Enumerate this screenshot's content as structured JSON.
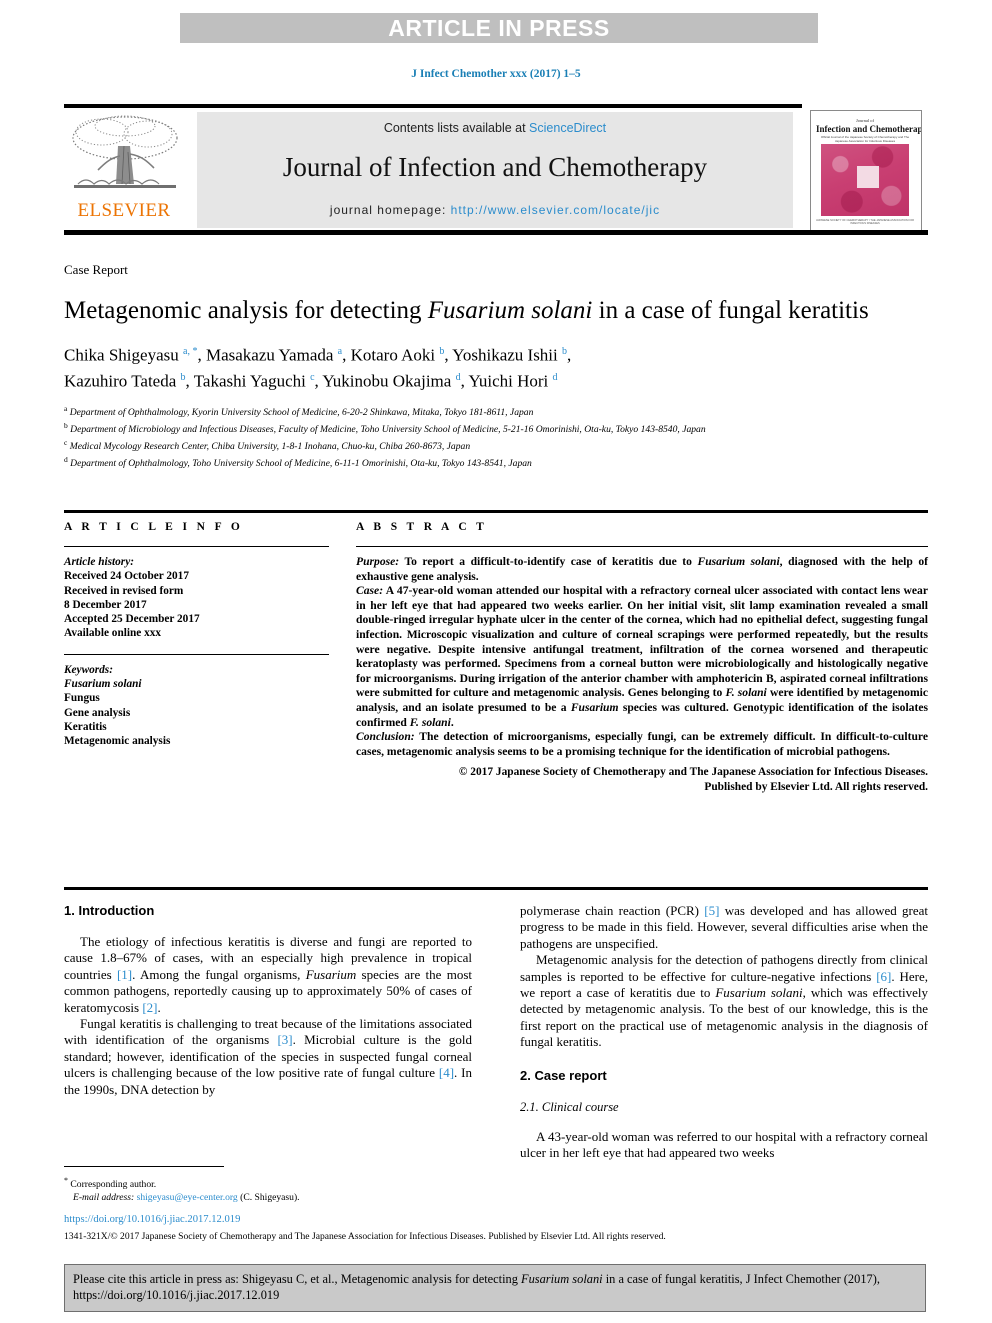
{
  "banner": {
    "label": "ARTICLE IN PRESS"
  },
  "running_citation": "J Infect Chemother xxx (2017) 1–5",
  "masthead": {
    "contents_prefix": "Contents lists available at ",
    "sciencedirect": "ScienceDirect",
    "journal_title": "Journal of Infection and Chemotherapy",
    "homepage_prefix": "journal homepage: ",
    "homepage_url": "http://www.elsevier.com/locate/jic",
    "publisher_logo_text": "ELSEVIER",
    "cover": {
      "line1": "Journal of",
      "line2": "Infection and Chemotherapy",
      "line3": "Official Journal of the Japanese Society of Chemotherapy and The Japanese Association for Infectious Diseases",
      "footer": "JAPANESE SOCIETY OF CHEMOTHERAPY / THE JAPANESE ASSOCIATION FOR INFECTIOUS DISEASES"
    }
  },
  "article": {
    "type_label": "Case Report",
    "title_part1": "Metagenomic analysis for detecting ",
    "title_italic": "Fusarium solani",
    "title_part2": " in a case of fungal keratitis",
    "authors_line1": "Chika Shigeyasu ",
    "authors_line1_sup1": "a, *",
    "authors_line1_b": ", Masakazu Yamada ",
    "authors_line1_sup2": "a",
    "authors_line1_c": ", Kotaro Aoki ",
    "authors_line1_sup3": "b",
    "authors_line1_d": ", Yoshikazu Ishii ",
    "authors_line1_sup4": "b",
    "authors_line1_e": ",",
    "authors_line2": "Kazuhiro Tateda ",
    "authors_line2_sup1": "b",
    "authors_line2_b": ", Takashi Yaguchi ",
    "authors_line2_sup2": "c",
    "authors_line2_c": ", Yukinobu Okajima ",
    "authors_line2_sup3": "d",
    "authors_line2_d": ", Yuichi Hori ",
    "authors_line2_sup4": "d",
    "affiliations": [
      {
        "marker": "a",
        "text": "Department of Ophthalmology, Kyorin University School of Medicine, 6-20-2 Shinkawa, Mitaka, Tokyo 181-8611, Japan"
      },
      {
        "marker": "b",
        "text": "Department of Microbiology and Infectious Diseases, Faculty of Medicine, Toho University School of Medicine, 5-21-16 Omorinishi, Ota-ku, Tokyo 143-8540, Japan"
      },
      {
        "marker": "c",
        "text": "Medical Mycology Research Center, Chiba University, 1-8-1 Inohana, Chuo-ku, Chiba 260-8673, Japan"
      },
      {
        "marker": "d",
        "text": "Department of Ophthalmology, Toho University School of Medicine, 6-11-1 Omorinishi, Ota-ku, Tokyo 143-8541, Japan"
      }
    ]
  },
  "article_info": {
    "heading": "A R T I C L E   I N F O",
    "history_label": "Article history:",
    "history": [
      "Received 24 October 2017",
      "Received in revised form",
      "8 December 2017",
      "Accepted 25 December 2017",
      "Available online xxx"
    ],
    "keywords_label": "Keywords:",
    "keywords": [
      "Fusarium solani",
      "Fungus",
      "Gene analysis",
      "Keratitis",
      "Metagenomic analysis"
    ]
  },
  "abstract": {
    "heading": "A B S T R A C T",
    "purpose_label": "Purpose:",
    "purpose_text_a": " To report a difficult-to-identify case of keratitis due to ",
    "purpose_italic": "Fusarium solani",
    "purpose_text_b": ", diagnosed with the help of exhaustive gene analysis.",
    "case_label": "Case:",
    "case_text_a": " A 47-year-old woman attended our hospital with a refractory corneal ulcer associated with contact lens wear in her left eye that had appeared two weeks earlier. On her initial visit, slit lamp examination revealed a small double-ringed irregular hyphate ulcer in the center of the cornea, which had no epithelial defect, suggesting fungal infection. Microscopic visualization and culture of corneal scrapings were performed repeatedly, but the results were negative. Despite intensive antifungal treatment, infiltration of the cornea worsened and therapeutic keratoplasty was performed. Specimens from a corneal button were microbiologically and histologically negative for microorganisms. During irrigation of the anterior chamber with amphotericin B, aspirated corneal infiltrations were submitted for culture and metagenomic analysis. Genes belonging to ",
    "case_italic1": "F. solani",
    "case_text_b": " were identified by metagenomic analysis, and an isolate presumed to be a ",
    "case_italic2": "Fusarium",
    "case_text_c": " species was cultured. Genotypic identification of the isolates confirmed ",
    "case_italic3": "F. solani",
    "case_text_d": ".",
    "conclusion_label": "Conclusion:",
    "conclusion_text": " The detection of microorganisms, especially fungi, can be extremely difficult. In difficult-to-culture cases, metagenomic analysis seems to be a promising technique for the identification of microbial pathogens.",
    "copyright_line1": "© 2017 Japanese Society of Chemotherapy and The Japanese Association for Infectious Diseases.",
    "copyright_line2": "Published by Elsevier Ltd. All rights reserved."
  },
  "body": {
    "left": {
      "section1_heading": "1. Introduction",
      "p1_a": "The etiology of infectious keratitis is diverse and fungi are reported to cause 1.8–67% of cases, with an especially high prevalence in tropical countries ",
      "p1_ref1": "[1]",
      "p1_b": ". Among the fungal organisms, ",
      "p1_italic": "Fusarium",
      "p1_c": " species are the most common pathogens, reportedly causing up to approximately 50% of cases of keratomycosis ",
      "p1_ref2": "[2]",
      "p1_d": ".",
      "p2_a": "Fungal keratitis is challenging to treat because of the limitations associated with identification of the organisms ",
      "p2_ref1": "[3]",
      "p2_b": ". Microbial culture is the gold standard; however, identification of the species in suspected fungal corneal ulcers is challenging because of the low positive rate of fungal culture ",
      "p2_ref2": "[4]",
      "p2_c": ". In the 1990s, DNA detection by"
    },
    "right": {
      "p3_a": "polymerase chain reaction (PCR) ",
      "p3_ref": "[5]",
      "p3_b": " was developed and has allowed great progress to be made in this field. However, several difficulties arise when the pathogens are unspecified.",
      "p4_a": "Metagenomic analysis for the detection of pathogens directly from clinical samples is reported to be effective for culture-negative infections ",
      "p4_ref": "[6]",
      "p4_b": ". Here, we report a case of keratitis due to ",
      "p4_italic": "Fusarium solani",
      "p4_c": ", which was effectively detected by metagenomic analysis. To the best of our knowledge, this is the first report on the practical use of metagenomic analysis in the diagnosis of fungal keratitis.",
      "section2_heading": "2. Case report",
      "subsection21_heading": "2.1. Clinical course",
      "p5": "A 43-year-old woman was referred to our hospital with a refractory corneal ulcer in her left eye that had appeared two weeks"
    }
  },
  "footer": {
    "corresponding_marker": "*",
    "corresponding_label": "Corresponding author.",
    "email_label": "E-mail address:",
    "email": "shigeyasu@eye-center.org",
    "email_owner": "(C. Shigeyasu).",
    "doi": "https://doi.org/10.1016/j.jiac.2017.12.019",
    "issn_line": "1341-321X/© 2017 Japanese Society of Chemotherapy and The Japanese Association for Infectious Diseases. Published by Elsevier Ltd. All rights reserved."
  },
  "citation_box": {
    "text_a": "Please cite this article in press as: Shigeyasu C, et al., Metagenomic analysis for detecting ",
    "italic": "Fusarium solani",
    "text_b": " in a case of fungal keratitis, J Infect Chemother (2017), https://doi.org/10.1016/j.jiac.2017.12.019"
  }
}
